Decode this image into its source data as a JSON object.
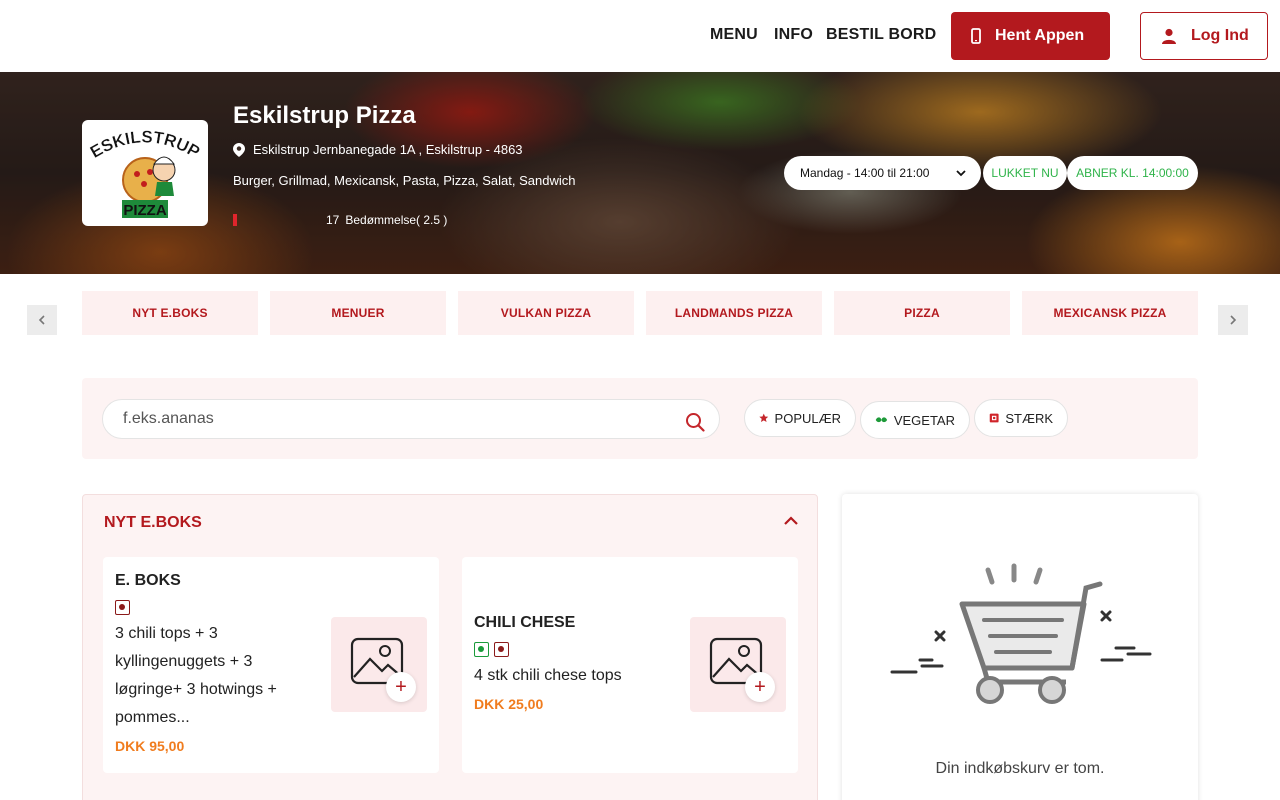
{
  "header": {
    "nav": [
      "MENU",
      "INFO",
      "BESTIL BORD"
    ],
    "app_button": "Hent Appen",
    "login_button": "Log Ind"
  },
  "restaurant": {
    "name": "Eskilstrup Pizza",
    "address": "Eskilstrup Jernbanegade 1A , Eskilstrup - 4863",
    "cuisines": "Burger, Grillmad, Mexicansk, Pasta, Pizza, Salat, Sandwich",
    "rating_value": 2.5,
    "rating_count": "17",
    "rating_label": "Bedømmelse( 2.5 )",
    "logo_text": "ESKILSTRUP",
    "logo_sub": "PIZZA",
    "hours": "Mandag - 14:00 til 21:00",
    "status": "LUKKET NU",
    "opens_at": "ABNER KL. 14:00:00"
  },
  "categories": [
    "NYT E.BOKS",
    "MENUER",
    "VULKAN PIZZA",
    "LANDMANDS PIZZA",
    "PIZZA",
    "MEXICANSK PIZZA"
  ],
  "search": {
    "placeholder": "f.eks.ananas"
  },
  "filters": [
    "POPULÆR",
    "VEGETAR",
    "STÆRK"
  ],
  "menu_section": {
    "title": "NYT E.BOKS",
    "items": [
      {
        "name": "E. BOKS",
        "description": "3 chili tops + 3 kyllingenuggets + 3 løgringe+ 3 hotwings + pommes...",
        "price": "DKK 95,00",
        "add": "+"
      },
      {
        "name": "CHILI CHESE",
        "description": "4 stk chili chese tops",
        "price": "DKK 25,00",
        "add": "+"
      }
    ]
  },
  "cart": {
    "empty_text": "Din indkøbskurv er tom."
  },
  "colors": {
    "brand": "#b3191e",
    "price": "#f07c1e",
    "open_status": "#2fb34a",
    "pill_bg": "#fdf0f0"
  }
}
